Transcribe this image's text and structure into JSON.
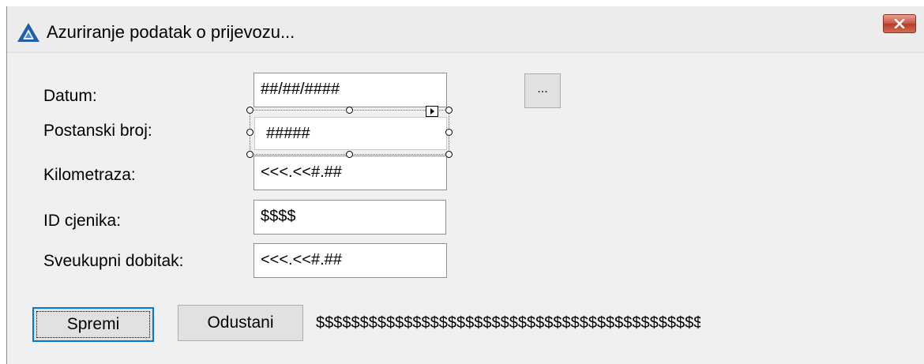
{
  "window": {
    "title": "Azuriranje podatak o prijevozu..."
  },
  "form": {
    "datum": {
      "label": "Datum:",
      "value": "##/##/####"
    },
    "postanski_broj": {
      "label": "Postanski broj:",
      "value": "#####"
    },
    "kilometraza": {
      "label": "Kilometraza:",
      "value": "<<<.<<#.##"
    },
    "id_cjenika": {
      "label": "ID cjenika:",
      "value": "$$$$"
    },
    "sveukupni_dobitak": {
      "label": "Sveukupni dobitak:",
      "value": "<<<.<<#.##"
    }
  },
  "buttons": {
    "browse": "...",
    "save": "Spremi",
    "cancel": "Odustani"
  },
  "status_text": "$$$$$$$$$$$$$$$$$$$$$$$$$$$$$$$$$$$$$$$$$$$$$$$$$$$$$$$$$$$",
  "icons": {
    "app": "triangle-logo-icon",
    "close": "close-icon"
  },
  "colors": {
    "close_button": "#c9543f",
    "default_button_border": "#0078d7",
    "app_icon": "#1e5fa8"
  }
}
